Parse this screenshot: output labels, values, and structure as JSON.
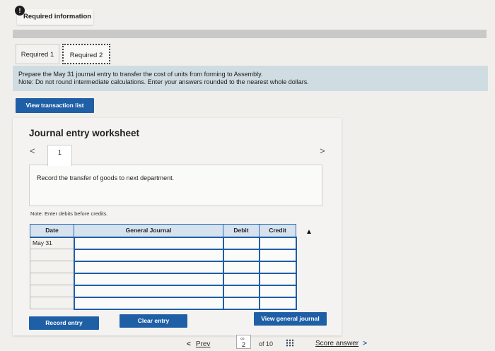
{
  "header": {
    "info_icon": "!",
    "required_info": "Required information"
  },
  "tabs": [
    {
      "label": "Required 1"
    },
    {
      "label": "Required 2"
    }
  ],
  "instructions": {
    "line1": "Prepare the May 31 journal entry to transfer the cost of units from forming to Assembly.",
    "line2": "Note: Do not round intermediate calculations. Enter your answers rounded to the nearest whole dollars."
  },
  "buttons": {
    "view_transaction_list": "View transaction list",
    "record_entry": "Record entry",
    "clear_entry": "Clear entry",
    "view_general_journal": "View general journal"
  },
  "worksheet": {
    "title": "Journal entry worksheet",
    "prev_arrow": "<",
    "next_arrow": ">",
    "current_tab": "1",
    "record_text": "Record the transfer of goods to next department.",
    "note": "Note: Enter debits before credits."
  },
  "journal": {
    "headers": {
      "date": "Date",
      "account": "General Journal",
      "debit": "Debit",
      "credit": "Credit"
    },
    "rows": [
      {
        "date": "May 31",
        "account": "",
        "debit": "",
        "credit": ""
      },
      {
        "date": "",
        "account": "",
        "debit": "",
        "credit": ""
      },
      {
        "date": "",
        "account": "",
        "debit": "",
        "credit": ""
      },
      {
        "date": "",
        "account": "",
        "debit": "",
        "credit": ""
      },
      {
        "date": "",
        "account": "",
        "debit": "",
        "credit": ""
      },
      {
        "date": "",
        "account": "",
        "debit": "",
        "credit": ""
      }
    ]
  },
  "nav": {
    "prev_chevron": "<",
    "prev_label": "Prev",
    "link_icon": "∞",
    "current_page": "2",
    "of_total": "of 10",
    "score_label": "Score answer",
    "score_chevron": ">"
  }
}
